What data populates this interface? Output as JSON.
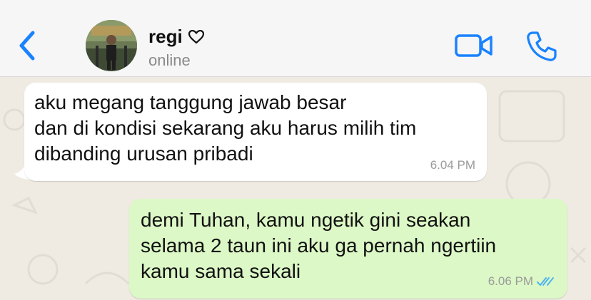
{
  "contact": {
    "name": "regi",
    "status": "online"
  },
  "messages": [
    {
      "direction": "incoming",
      "text": "aku megang tanggung jawab besar\ndan di kondisi sekarang aku harus milih tim\ndibanding urusan pribadi",
      "time": "6.04 PM"
    },
    {
      "direction": "outgoing",
      "text": "demi Tuhan, kamu ngetik gini seakan\nselama 2 taun ini aku ga pernah ngertiin\nkamu sama sekali",
      "time": "6.06 PM",
      "read_status": "read"
    }
  ],
  "colors": {
    "accent": "#1a82ff",
    "incoming_bubble": "#ffffff",
    "outgoing_bubble": "#dcf8c6",
    "read_ticks": "#4fb4f0",
    "wallpaper": "#efeae2"
  },
  "icons": {
    "back": "chevron-left-icon",
    "heart": "heart-outline-icon",
    "video": "video-camera-icon",
    "call": "phone-icon",
    "read": "double-check-icon"
  }
}
